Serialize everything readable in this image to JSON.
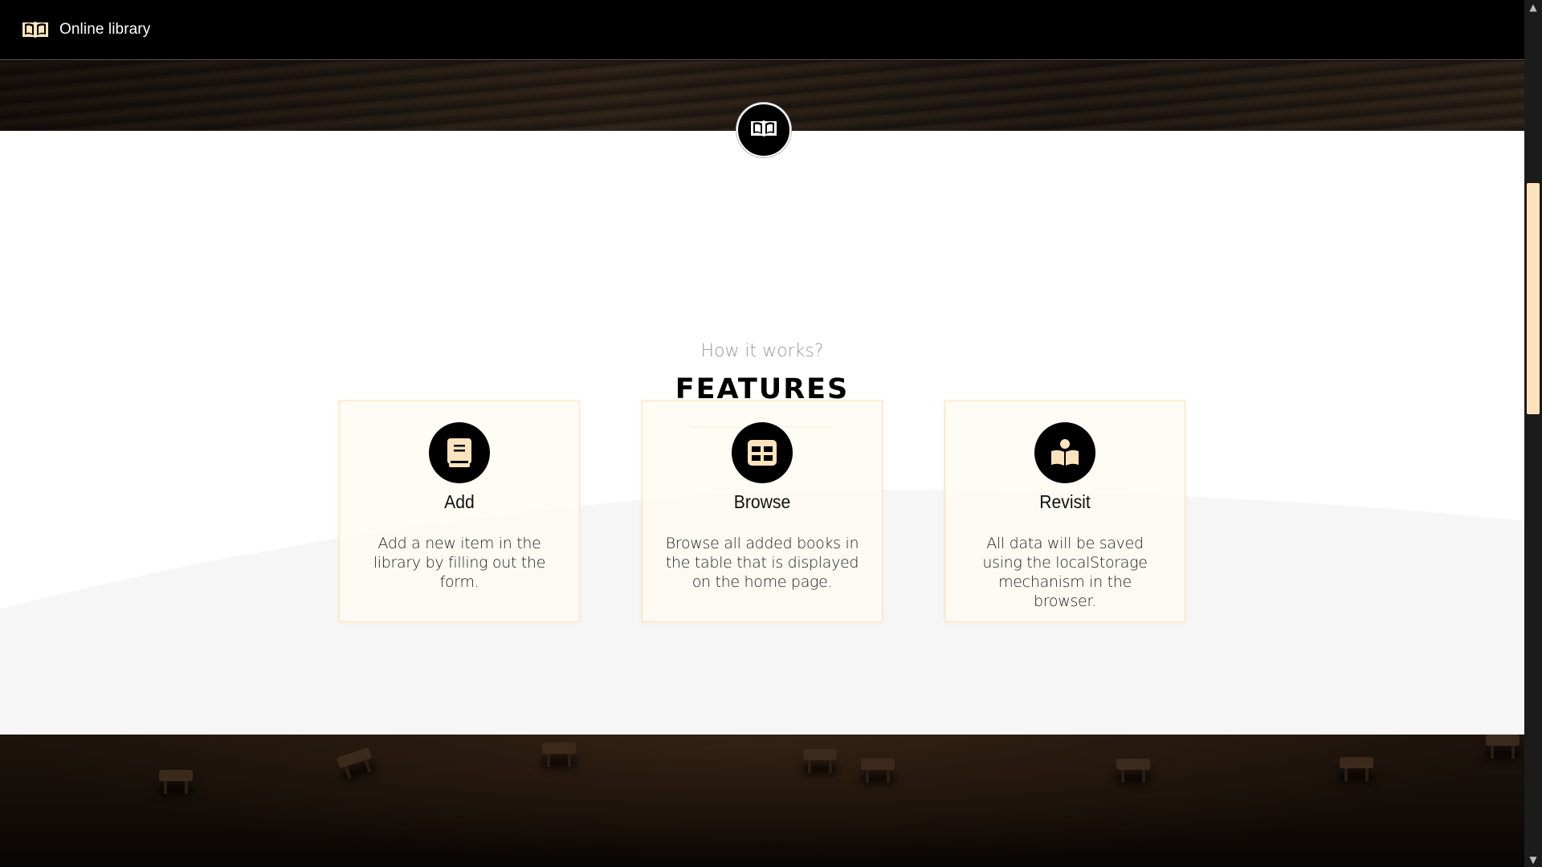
{
  "app": {
    "title": "Online library"
  },
  "features": {
    "subtitle": "How it works?",
    "title": "FEATURES",
    "cards": [
      {
        "icon": "book-icon",
        "title": "Add",
        "description": "Add a new item in the library by filling out the form."
      },
      {
        "icon": "table-icon",
        "title": "Browse",
        "description": "Browse all added books in the table that is displayed on the home page."
      },
      {
        "icon": "reader-icon",
        "title": "Revisit",
        "description": "All data will be saved using the localStorage mechanism in the browser."
      }
    ]
  },
  "colors": {
    "accent": "#fde3bd",
    "navbar_bg": "#000000",
    "text_dark": "#111111"
  },
  "icons": {
    "brand": "open-book-icon",
    "center_badge": "open-book-icon",
    "divider": "bookmark-icon",
    "scroll_up": "chevron-up-icon",
    "scroll_down": "chevron-down-icon"
  }
}
